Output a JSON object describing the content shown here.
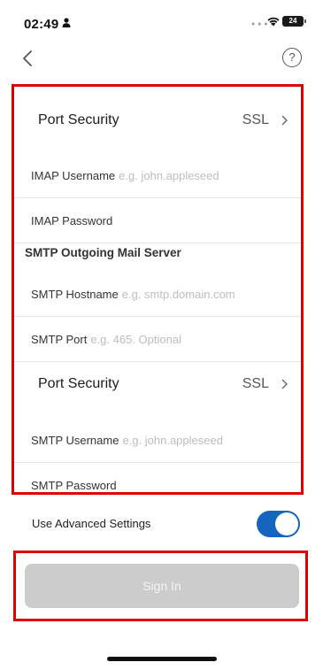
{
  "status_bar": {
    "time": "02:49",
    "battery": "24"
  },
  "form": {
    "imap_port_security": {
      "label": "Port Security",
      "value": "SSL"
    },
    "imap_username": {
      "label": "IMAP Username",
      "placeholder": "e.g. john.appleseed"
    },
    "imap_password": {
      "label": "IMAP Password"
    },
    "smtp_header": "SMTP Outgoing Mail Server",
    "smtp_hostname": {
      "label": "SMTP Hostname",
      "placeholder": "e.g. smtp.domain.com"
    },
    "smtp_port": {
      "label": "SMTP Port",
      "placeholder": "e.g. 465. Optional"
    },
    "smtp_port_security": {
      "label": "Port Security",
      "value": "SSL"
    },
    "smtp_username": {
      "label": "SMTP Username",
      "placeholder": "e.g. john.appleseed"
    },
    "smtp_password": {
      "label": "SMTP Password"
    }
  },
  "advanced": {
    "label": "Use Advanced Settings",
    "enabled": true
  },
  "sign_in": {
    "label": "Sign In",
    "enabled": false
  },
  "colors": {
    "accent": "#1565c0",
    "highlight": "#e00000",
    "disabled_button": "#cccccc"
  }
}
